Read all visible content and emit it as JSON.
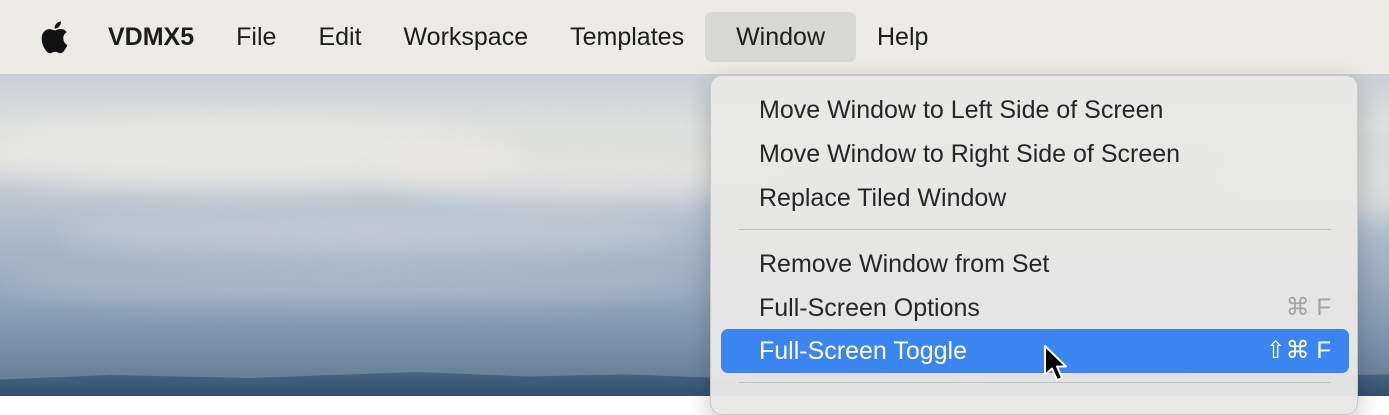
{
  "menubar": {
    "apple_icon": "apple-logo-icon",
    "app_name": "VDMX5",
    "items": [
      "File",
      "Edit",
      "Workspace",
      "Templates",
      "Window",
      "Help"
    ],
    "active_item": "Window"
  },
  "window_menu": {
    "items": [
      {
        "label": "Move Window to Left Side of Screen",
        "shortcut": ""
      },
      {
        "label": "Move Window to Right Side of Screen",
        "shortcut": ""
      },
      {
        "label": "Replace Tiled Window",
        "shortcut": ""
      },
      {
        "label": "Remove Window from Set",
        "shortcut": ""
      },
      {
        "label": "Full-Screen Options",
        "shortcut": "⌘ F"
      },
      {
        "label": "Full-Screen Toggle",
        "shortcut": "⇧⌘ F"
      }
    ],
    "highlighted_item": "Full-Screen Toggle"
  },
  "colors": {
    "menubar_bg": "#ecebe6",
    "highlight": "#3a85f0"
  },
  "cursor_icon": "arrow-pointer-icon"
}
